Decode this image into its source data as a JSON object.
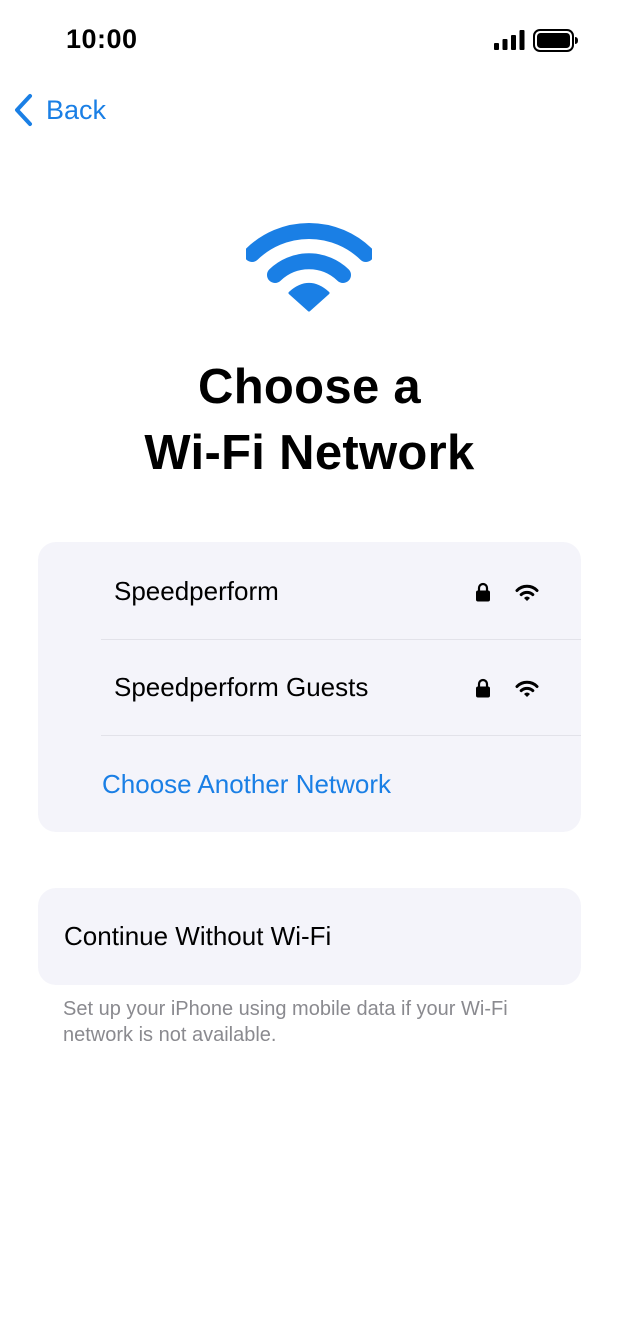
{
  "status_bar": {
    "time": "10:00",
    "icons": [
      "cellular-signal-icon",
      "battery-icon"
    ]
  },
  "nav": {
    "back_label": "Back",
    "back_icon": "chevron-left-icon"
  },
  "hero": {
    "icon": "wifi-icon",
    "title_line1": "Choose a",
    "title_line2": "Wi-Fi Network"
  },
  "networks": [
    {
      "name": "Speedperform",
      "secured": true,
      "signal": "full"
    },
    {
      "name": "Speedperform Guests",
      "secured": true,
      "signal": "full"
    }
  ],
  "choose_another_label": "Choose Another Network",
  "continue_without_label": "Continue Without Wi-Fi",
  "footnote": "Set up your iPhone using mobile data if your Wi-Fi network is not available.",
  "colors": {
    "accent": "#1a7fe5",
    "card_background": "#f4f4fa",
    "secondary_text": "#8a8a8f"
  }
}
